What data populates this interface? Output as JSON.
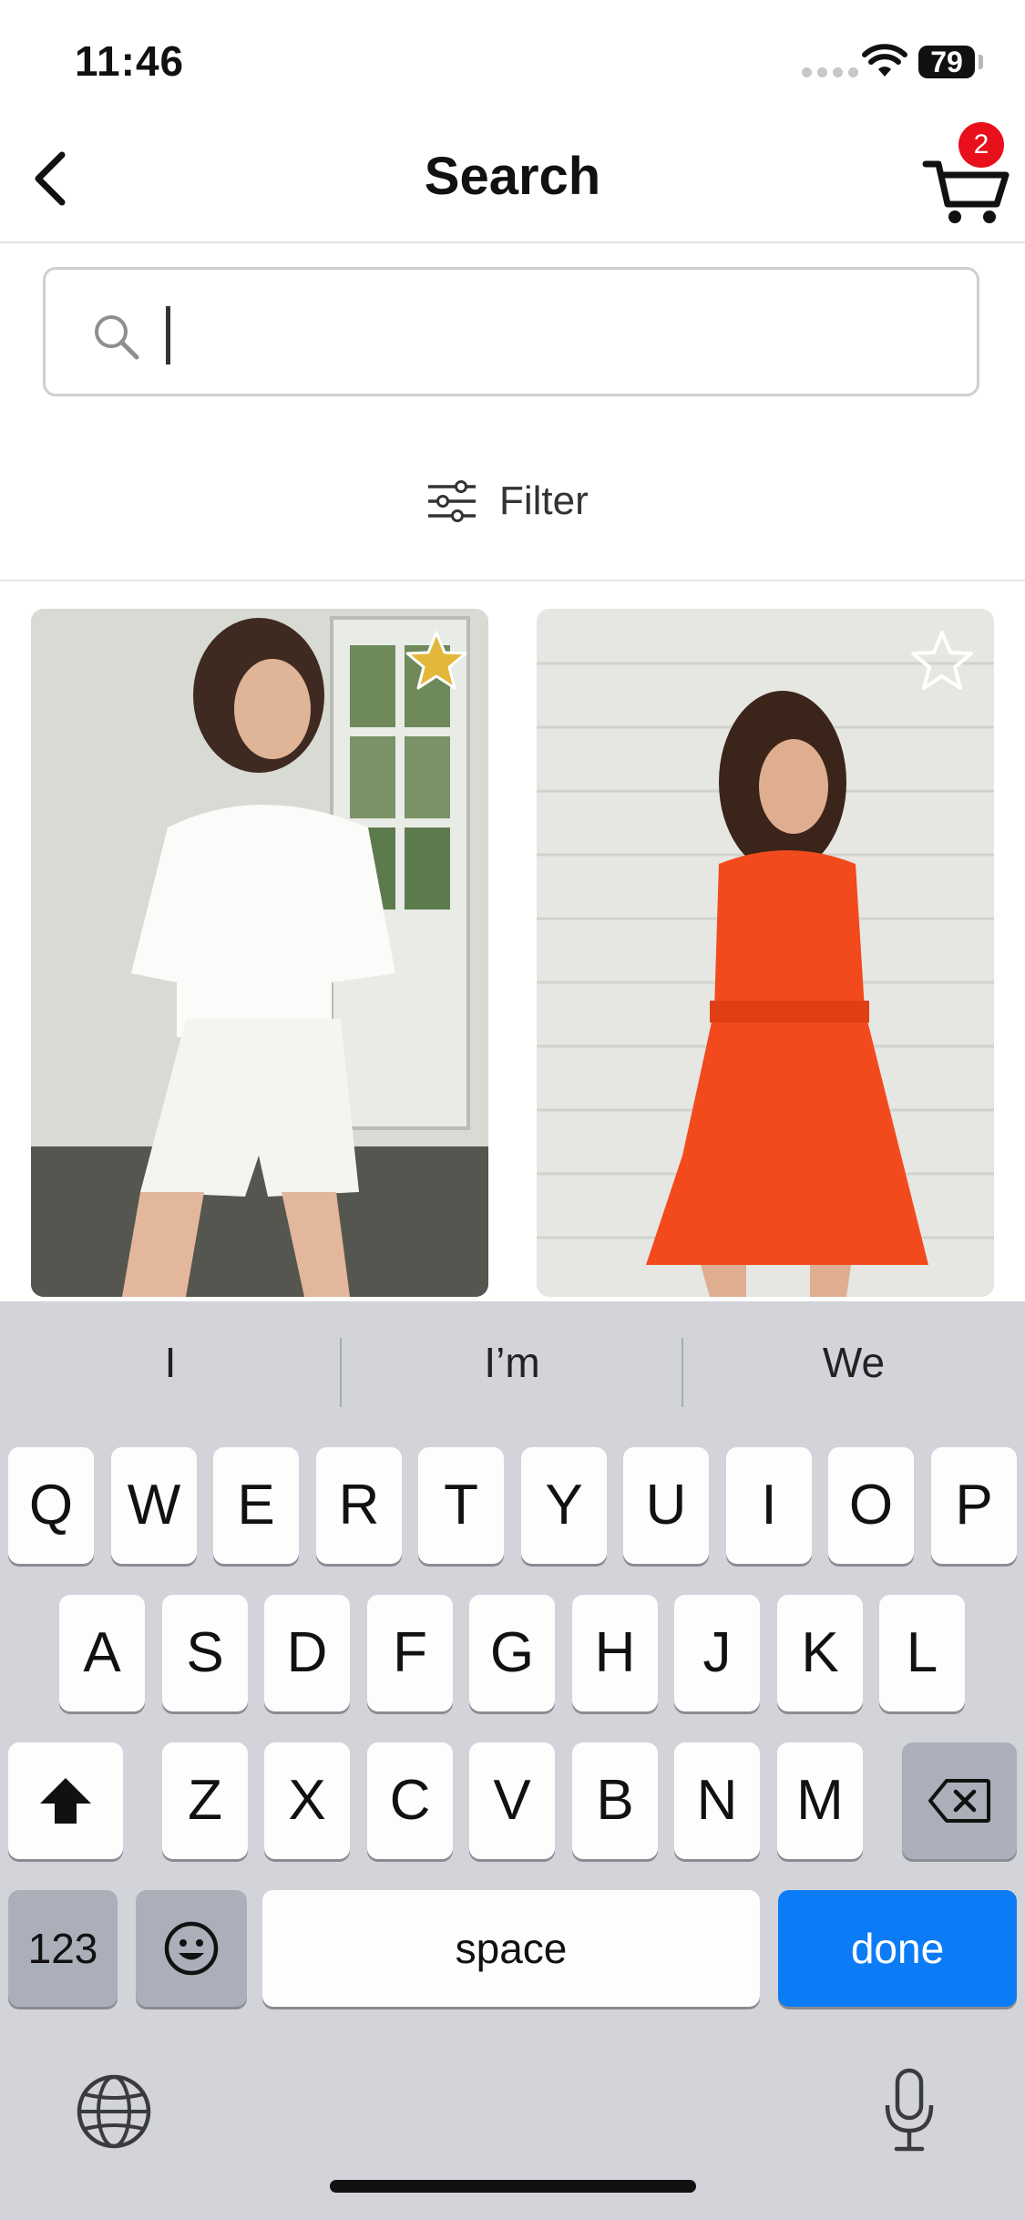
{
  "status": {
    "time": "11:46",
    "battery": "79"
  },
  "nav": {
    "title": "Search",
    "cart_count": "2"
  },
  "search": {
    "value": "",
    "placeholder": ""
  },
  "filter": {
    "label": "Filter"
  },
  "products": [
    {
      "favorite": true,
      "star_color": "#e3b83a"
    },
    {
      "favorite": false,
      "star_color": "#ffffff"
    }
  ],
  "keyboard": {
    "suggestions": [
      "I",
      "I’m",
      "We"
    ],
    "row1": [
      "Q",
      "W",
      "E",
      "R",
      "T",
      "Y",
      "U",
      "I",
      "O",
      "P"
    ],
    "row2": [
      "A",
      "S",
      "D",
      "F",
      "G",
      "H",
      "J",
      "K",
      "L"
    ],
    "row3": [
      "Z",
      "X",
      "C",
      "V",
      "B",
      "N",
      "M"
    ],
    "numbers_key": "123",
    "space_key": "space",
    "done_key": "done"
  },
  "colors": {
    "badge": "#e8101b",
    "done_key": "#0b7cf5",
    "keyboard_bg": "#d2d4da"
  }
}
